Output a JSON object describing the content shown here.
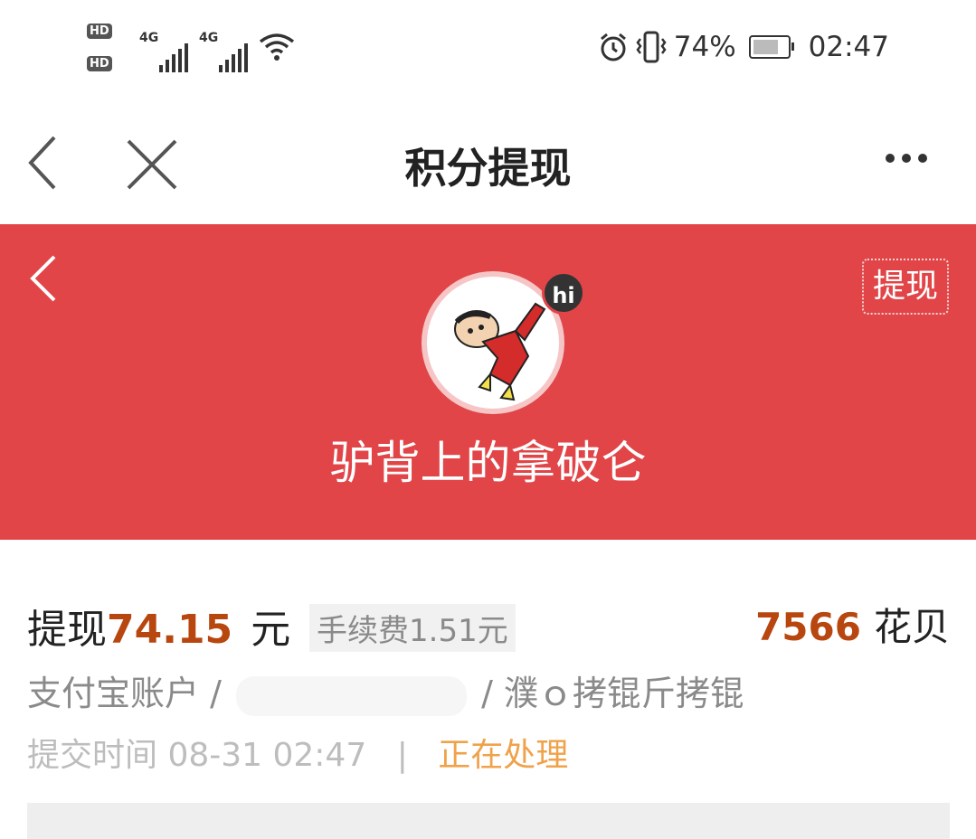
{
  "status_bar": {
    "battery_percent": "74%",
    "time": "02:47",
    "signal_label": "4G",
    "sim1": "HD",
    "sim2": "HD"
  },
  "nav": {
    "title": "积分提现"
  },
  "banner": {
    "username": "驴背上的拿破仑",
    "withdraw_button": "提现",
    "hi_badge": "hi",
    "color": "#e14548"
  },
  "withdrawal": {
    "label": "提现",
    "amount": "74.15",
    "unit": "元",
    "fee": "手续费1.51元",
    "points_value": "7566",
    "points_unit": "花贝",
    "account_prefix": "支付宝账户 /",
    "account_suffix": "/ 濮ｏ拷锟斤拷锟",
    "submit_time": "提交时间 08-31 02:47",
    "separator": "|",
    "status": "正在处理"
  },
  "colors": {
    "accent_amount": "#b8460f",
    "status_processing": "#f0a24a"
  }
}
